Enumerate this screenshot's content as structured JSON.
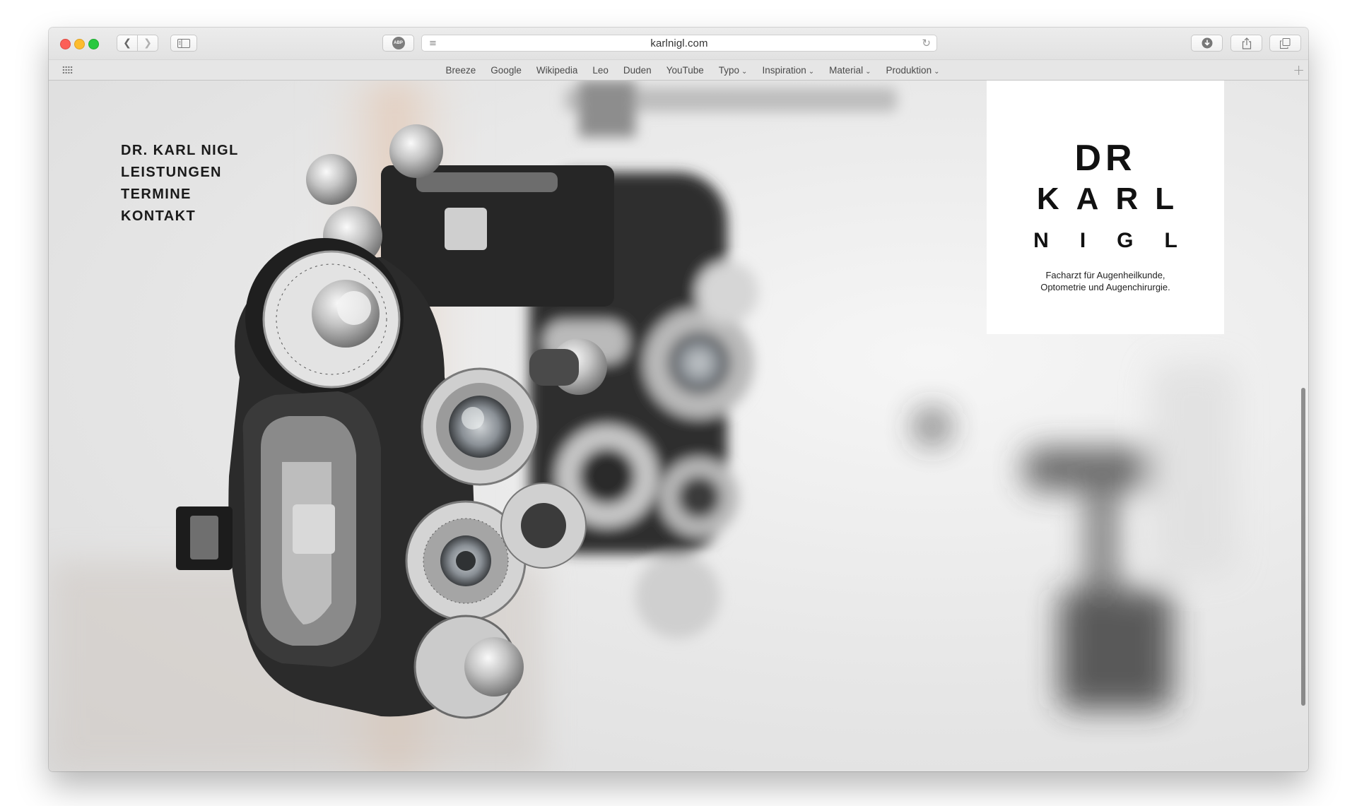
{
  "browser": {
    "url": "karlnigl.com",
    "adblock_label": "ABP",
    "icons": {
      "back": "chevron-left-icon",
      "forward": "chevron-right-icon",
      "sidebar": "sidebar-icon",
      "reader": "reader-icon",
      "reload": "reload-icon",
      "download": "download-icon",
      "share": "share-icon",
      "tabs": "tabs-icon",
      "add": "plus-icon",
      "favorites": "grid-icon"
    },
    "bookmarks": [
      {
        "label": "Breeze"
      },
      {
        "label": "Google"
      },
      {
        "label": "Wikipedia"
      },
      {
        "label": "Leo"
      },
      {
        "label": "Duden"
      },
      {
        "label": "YouTube"
      },
      {
        "label": "Typo",
        "menu": true
      },
      {
        "label": "Inspiration",
        "menu": true
      },
      {
        "label": "Material",
        "menu": true
      },
      {
        "label": "Produktion",
        "menu": true
      }
    ]
  },
  "site": {
    "nav": [
      "DR. KARL NIGL",
      "LEISTUNGEN",
      "TERMINE",
      "KONTAKT"
    ],
    "logo": {
      "line1": "DR",
      "line2": "KARL",
      "line3": "NIGL",
      "tagline_1": "Facharzt für Augenheilkunde,",
      "tagline_2": "Optometrie und Augenchirurgie."
    },
    "hero_image": "phoropter-photo"
  },
  "colors": {
    "close": "#fc5f57",
    "minimize": "#fdbc2e",
    "zoom": "#28c840",
    "text_dark": "#1a1a1a"
  }
}
